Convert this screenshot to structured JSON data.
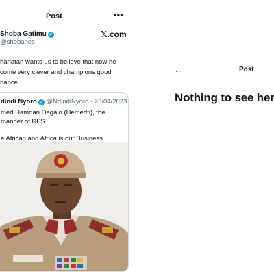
{
  "left_panel": {
    "header": {
      "title": "Post",
      "more_icon": "more-horizontal-icon"
    },
    "author": {
      "name": "Shoba Gatimu",
      "handle": "@shobanes",
      "verified_icon": "verified-badge-icon"
    },
    "logo_text": "𝕏.com",
    "tweet_lines": [
      "harlatan wants us to believe that now he",
      "come very clever and champions good",
      "nance."
    ],
    "quote": {
      "author_name": "dindi Nyoro",
      "author_meta": "@NdindiNyoro · 23/04/2023",
      "lines": [
        "med Hamdan Dagalo (Hemedti), the",
        "mander of RFS.",
        "",
        "e African and Africa is our Business.."
      ],
      "image_icon": "portrait-photo-icon"
    }
  },
  "right_panel": {
    "back_icon": "back-arrow-icon",
    "header": {
      "title": "Post"
    },
    "empty_title": "Nothing to see here"
  },
  "colors": {
    "text": "#0f1419",
    "muted": "#536471",
    "verified": "#1d9bf0",
    "border": "#cfd9de"
  }
}
